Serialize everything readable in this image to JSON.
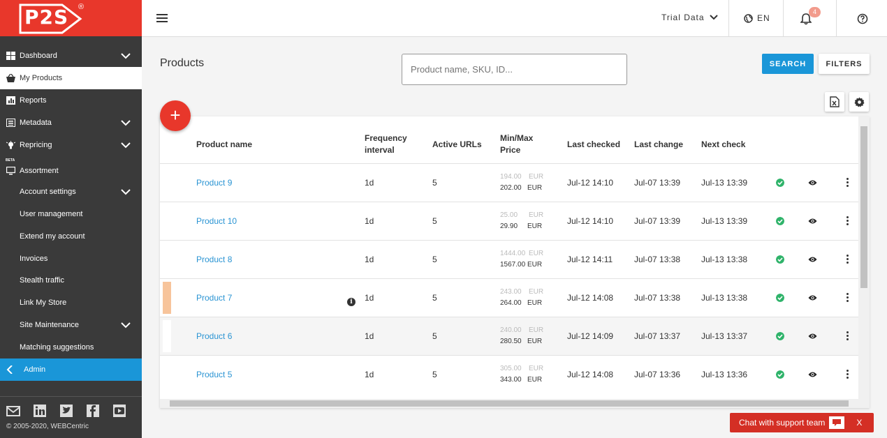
{
  "brand": {
    "logo": "P2S",
    "reg": "®"
  },
  "sidebar": {
    "items": [
      {
        "label": "Dashboard"
      },
      {
        "label": "My Products"
      },
      {
        "label": "Reports"
      },
      {
        "label": "Metadata"
      },
      {
        "label": "Repricing"
      },
      {
        "label": "Assortment",
        "badge": "BETA"
      },
      {
        "label": "Account settings"
      },
      {
        "label": "User management"
      },
      {
        "label": "Extend my account"
      },
      {
        "label": "Invoices"
      },
      {
        "label": "Stealth traffic"
      },
      {
        "label": "Link My Store"
      },
      {
        "label": "Site Maintenance"
      },
      {
        "label": "Matching suggestions"
      },
      {
        "label": "Admin"
      }
    ],
    "copyright": "© 2005-2020, WEBCentric"
  },
  "topbar": {
    "trial_label": "Trial Data",
    "lang": "EN",
    "notif_count": "4"
  },
  "main": {
    "title": "Products",
    "search_placeholder": "Product name, SKU, ID...",
    "search_label": "SEARCH",
    "filters_label": "FILTERS",
    "add_label": "+"
  },
  "table": {
    "headers": {
      "name": "Product name",
      "freq1": "Frequency",
      "freq2": "interval",
      "urls": "Active URLs",
      "price1": "Min/Max",
      "price2": "Price",
      "checked": "Last checked",
      "change": "Last change",
      "next": "Next check"
    },
    "rows": [
      {
        "name": "Product 9",
        "freq": "1d",
        "urls": "5",
        "min": "194.00",
        "max": "202.00",
        "cur": "EUR",
        "checked": "Jul-12 14:10",
        "change": "Jul-07 13:39",
        "next": "Jul-13 13:39"
      },
      {
        "name": "Product 10",
        "freq": "1d",
        "urls": "5",
        "min": "25.00",
        "max": "29.90",
        "cur": "EUR",
        "checked": "Jul-12 14:10",
        "change": "Jul-07 13:39",
        "next": "Jul-13 13:39"
      },
      {
        "name": "Product 8",
        "freq": "1d",
        "urls": "5",
        "min": "1444.00",
        "max": "1567.00",
        "cur": "EUR",
        "checked": "Jul-12 14:11",
        "change": "Jul-07 13:38",
        "next": "Jul-13 13:38"
      },
      {
        "name": "Product 7",
        "freq": "1d",
        "urls": "5",
        "min": "243.00",
        "max": "264.00",
        "cur": "EUR",
        "checked": "Jul-12 14:08",
        "change": "Jul-07 13:38",
        "next": "Jul-13 13:38"
      },
      {
        "name": "Product 6",
        "freq": "1d",
        "urls": "5",
        "min": "240.00",
        "max": "280.50",
        "cur": "EUR",
        "checked": "Jul-12 14:09",
        "change": "Jul-07 13:37",
        "next": "Jul-13 13:37"
      },
      {
        "name": "Product 5",
        "freq": "1d",
        "urls": "5",
        "min": "305.00",
        "max": "343.00",
        "cur": "EUR",
        "checked": "Jul-12 14:08",
        "change": "Jul-07 13:36",
        "next": "Jul-13 13:36"
      }
    ]
  },
  "chat": {
    "label": "Chat with support team",
    "close": "X"
  },
  "colors": {
    "brand_red": "#e8372b",
    "accent_blue": "#1a96d8",
    "ok_green": "#2fb36a",
    "row_marker_orange": "#f7c49b"
  }
}
